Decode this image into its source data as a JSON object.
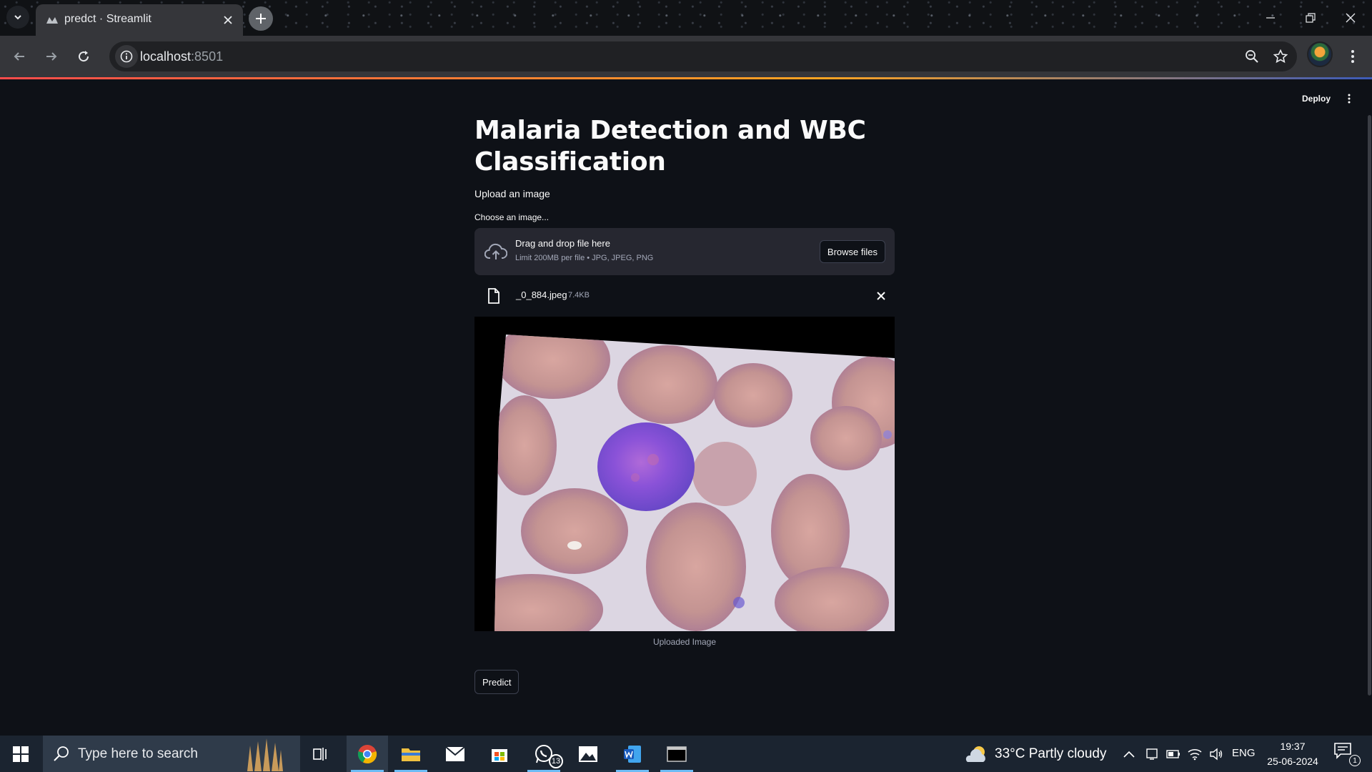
{
  "browser": {
    "tab_title": "predct · Streamlit",
    "url_host": "localhost",
    "url_port": ":8501"
  },
  "app": {
    "deploy_label": "Deploy",
    "title": "Malaria Detection and WBC Classification",
    "subtitle": "Upload an image",
    "uploader": {
      "label": "Choose an image...",
      "drop_title": "Drag and drop file here",
      "limit_text": "Limit 200MB per file • JPG, JPEG, PNG",
      "browse_label": "Browse files"
    },
    "uploaded_file": {
      "name": "_0_884.jpeg",
      "size": "7.4KB"
    },
    "image_caption": "Uploaded Image",
    "predict_label": "Predict"
  },
  "taskbar": {
    "search_placeholder": "Type here to search",
    "whatsapp_badge": "13",
    "weather": "33°C  Partly cloudy",
    "language": "ENG",
    "time": "19:37",
    "date": "25-06-2024",
    "notification_count": "1"
  },
  "colors": {
    "app_bg": "#0e1117",
    "dropzone_bg": "#262730",
    "accent_red": "#ff4b4b",
    "taskbar_bg": "#1b2430"
  }
}
